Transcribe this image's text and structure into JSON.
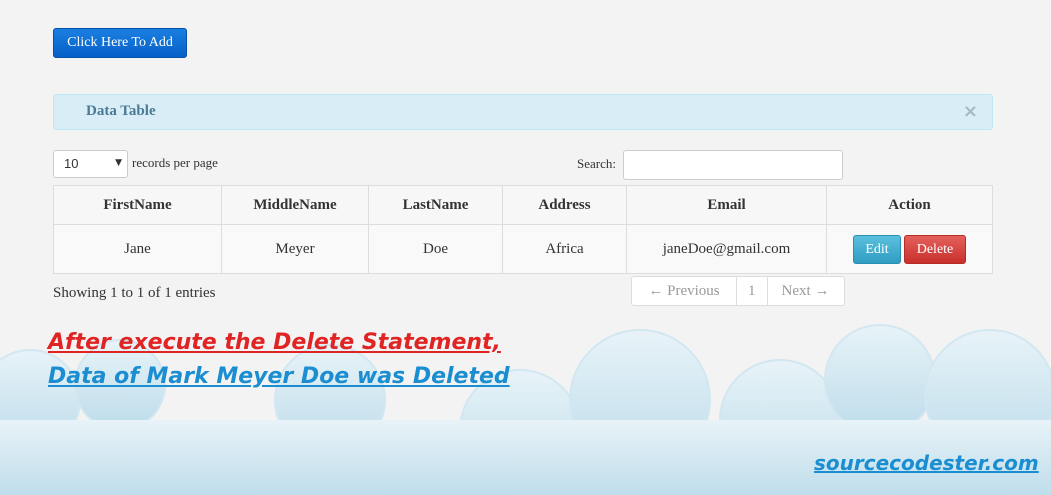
{
  "toolbar": {
    "add_label": "Click Here To Add"
  },
  "alert": {
    "title": "Data Table",
    "close": "×"
  },
  "table_controls": {
    "length_value": "10",
    "length_label": "records per page",
    "search_label": "Search:",
    "search_value": ""
  },
  "table": {
    "headers": [
      "FirstName",
      "MiddleName",
      "LastName",
      "Address",
      "Email",
      "Action"
    ],
    "rows": [
      {
        "first": "Jane",
        "middle": "Meyer",
        "last": "Doe",
        "address": "Africa",
        "email": "janeDoe@gmail.com",
        "edit_label": "Edit",
        "delete_label": "Delete"
      }
    ]
  },
  "info": "Showing 1 to 1 of 1 entries",
  "pagination": {
    "previous": "← Previous",
    "page": "1",
    "next": "Next →"
  },
  "notes": {
    "line1": "After execute the Delete Statement,",
    "line2": "Data of Mark Meyer Doe was Deleted"
  },
  "brand": "sourcecodester.com",
  "colors": {
    "primary_button": "#0a6fd6",
    "info_button": "#5bc0de",
    "danger_button": "#d9534f",
    "note_red": "#e02424",
    "note_blue": "#1a8ed1"
  }
}
